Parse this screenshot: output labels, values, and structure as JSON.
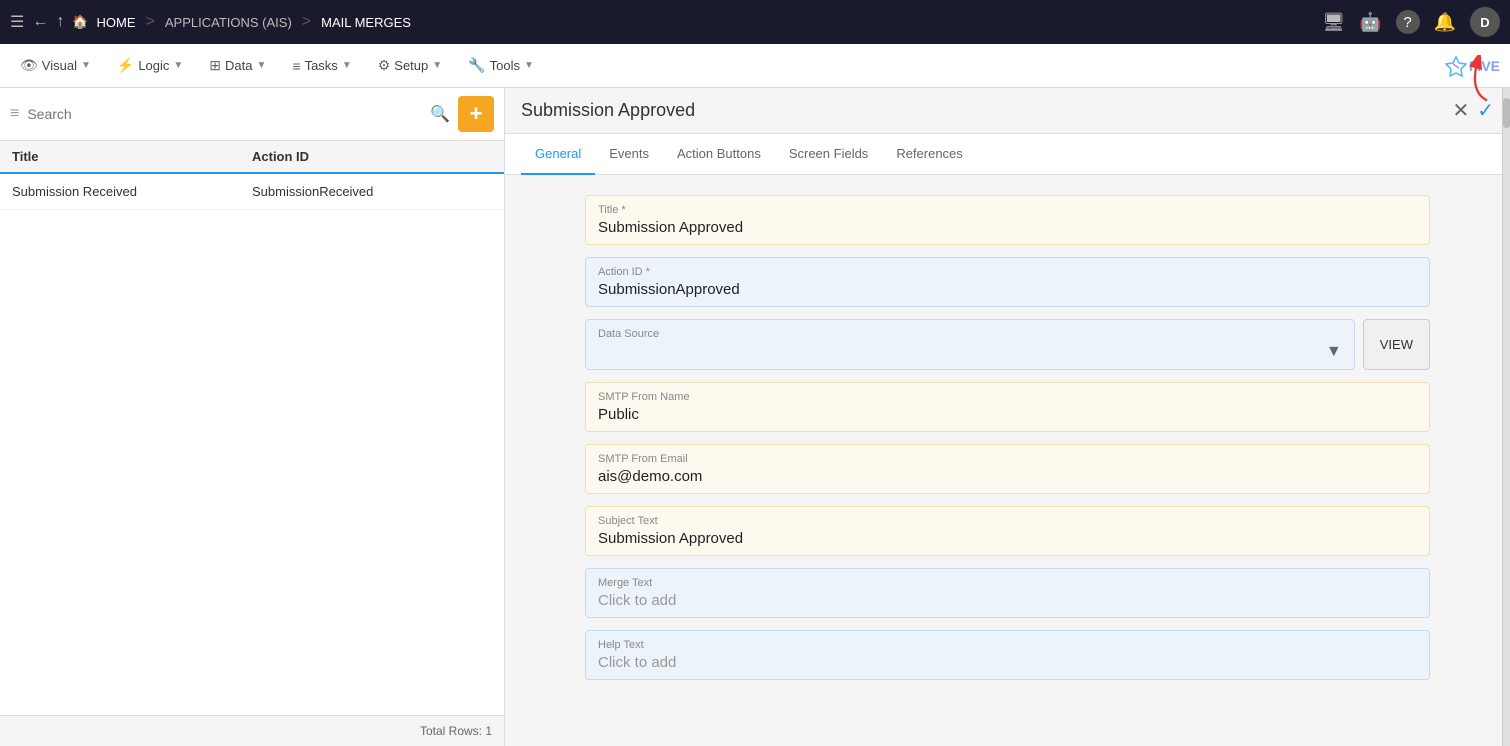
{
  "topNav": {
    "menuIcon": "☰",
    "backIcon": "←",
    "upIcon": "↑",
    "homeLabel": "HOME",
    "sep1": ">",
    "applicationsLabel": "APPLICATIONS (AIS)",
    "sep2": ">",
    "mailMergesLabel": "MAIL MERGES",
    "icons": {
      "monitor": "🖥",
      "agent": "🤖",
      "help": "?",
      "bell": "🔔"
    },
    "avatarLabel": "D",
    "fiveLogoText": "★ FIVE"
  },
  "secondNav": {
    "items": [
      {
        "id": "visual",
        "icon": "👁",
        "label": "Visual"
      },
      {
        "id": "logic",
        "icon": "⚡",
        "label": "Logic"
      },
      {
        "id": "data",
        "icon": "⊞",
        "label": "Data"
      },
      {
        "id": "tasks",
        "icon": "☰",
        "label": "Tasks"
      },
      {
        "id": "setup",
        "icon": "⚙",
        "label": "Setup"
      },
      {
        "id": "tools",
        "icon": "🔧",
        "label": "Tools"
      }
    ]
  },
  "leftPanel": {
    "searchPlaceholder": "Search",
    "addButtonLabel": "+",
    "columns": [
      {
        "id": "title",
        "label": "Title"
      },
      {
        "id": "actionId",
        "label": "Action ID"
      }
    ],
    "rows": [
      {
        "title": "Submission Received",
        "actionId": "SubmissionReceived"
      }
    ],
    "totalRows": "Total Rows: 1"
  },
  "rightPanel": {
    "title": "Submission Approved",
    "closeIcon": "✕",
    "checkIcon": "✓",
    "tabs": [
      {
        "id": "general",
        "label": "General",
        "active": true
      },
      {
        "id": "events",
        "label": "Events",
        "active": false
      },
      {
        "id": "actionButtons",
        "label": "Action Buttons",
        "active": false
      },
      {
        "id": "screenFields",
        "label": "Screen Fields",
        "active": false
      },
      {
        "id": "references",
        "label": "References",
        "active": false
      }
    ],
    "form": {
      "titleField": {
        "label": "Title *",
        "value": "Submission Approved"
      },
      "actionIdField": {
        "label": "Action ID *",
        "value": "SubmissionApproved"
      },
      "dataSourceField": {
        "label": "Data Source",
        "value": "",
        "dropdownIcon": "▼"
      },
      "viewButtonLabel": "VIEW",
      "smtpFromNameField": {
        "label": "SMTP From Name",
        "value": "Public"
      },
      "smtpFromEmailField": {
        "label": "SMTP From Email",
        "value": "ais@demo.com"
      },
      "subjectTextField": {
        "label": "Subject Text",
        "value": "Submission Approved"
      },
      "mergeTextField": {
        "label": "Merge Text",
        "value": "Click to add"
      },
      "helpTextField": {
        "label": "Help Text",
        "value": "Click to add"
      }
    }
  },
  "arrow": {
    "color": "#e53935"
  }
}
